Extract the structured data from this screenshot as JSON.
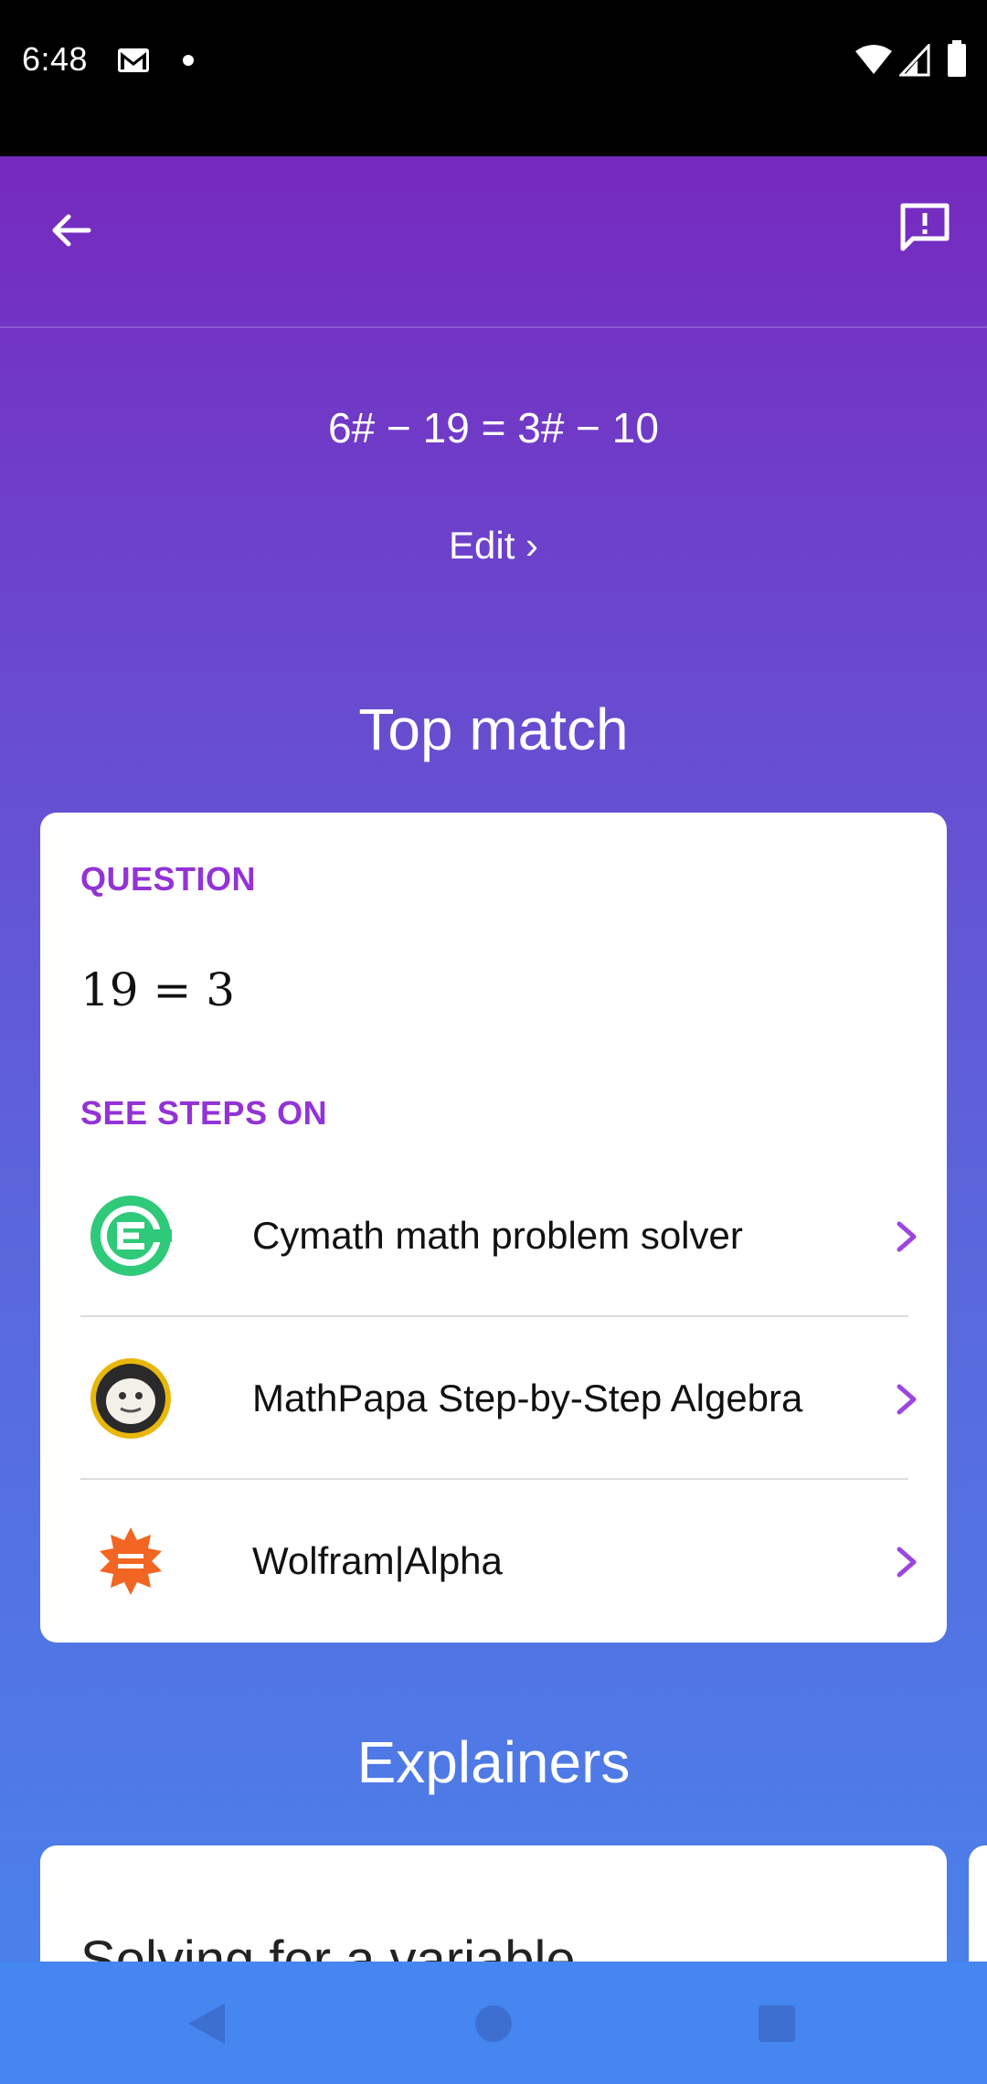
{
  "status_bar": {
    "time": "6:48"
  },
  "header": {
    "back_icon": "arrow-left-icon",
    "feedback_icon": "feedback-icon"
  },
  "query": {
    "equation": "6# − 19 = 3# − 10",
    "edit_label": "Edit ›"
  },
  "top_match": {
    "title": "Top match",
    "question_label": "QUESTION",
    "question_math": "19 = 3",
    "steps_label": "SEE STEPS ON",
    "steps": [
      {
        "label": "Cymath math problem solver",
        "icon": "cymath-logo-icon"
      },
      {
        "label": "MathPapa Step-by-Step Algebra",
        "icon": "mathpapa-logo-icon"
      },
      {
        "label": "Wolfram|Alpha",
        "icon": "wolfram-logo-icon"
      }
    ]
  },
  "explainers": {
    "title": "Explainers",
    "cards": [
      {
        "title": "Solving for a variable"
      }
    ]
  },
  "colors": {
    "accent": "#9333d6",
    "gradient_top": "#7629be",
    "gradient_bottom": "#4b80ea",
    "navbar": "#4586f1"
  }
}
